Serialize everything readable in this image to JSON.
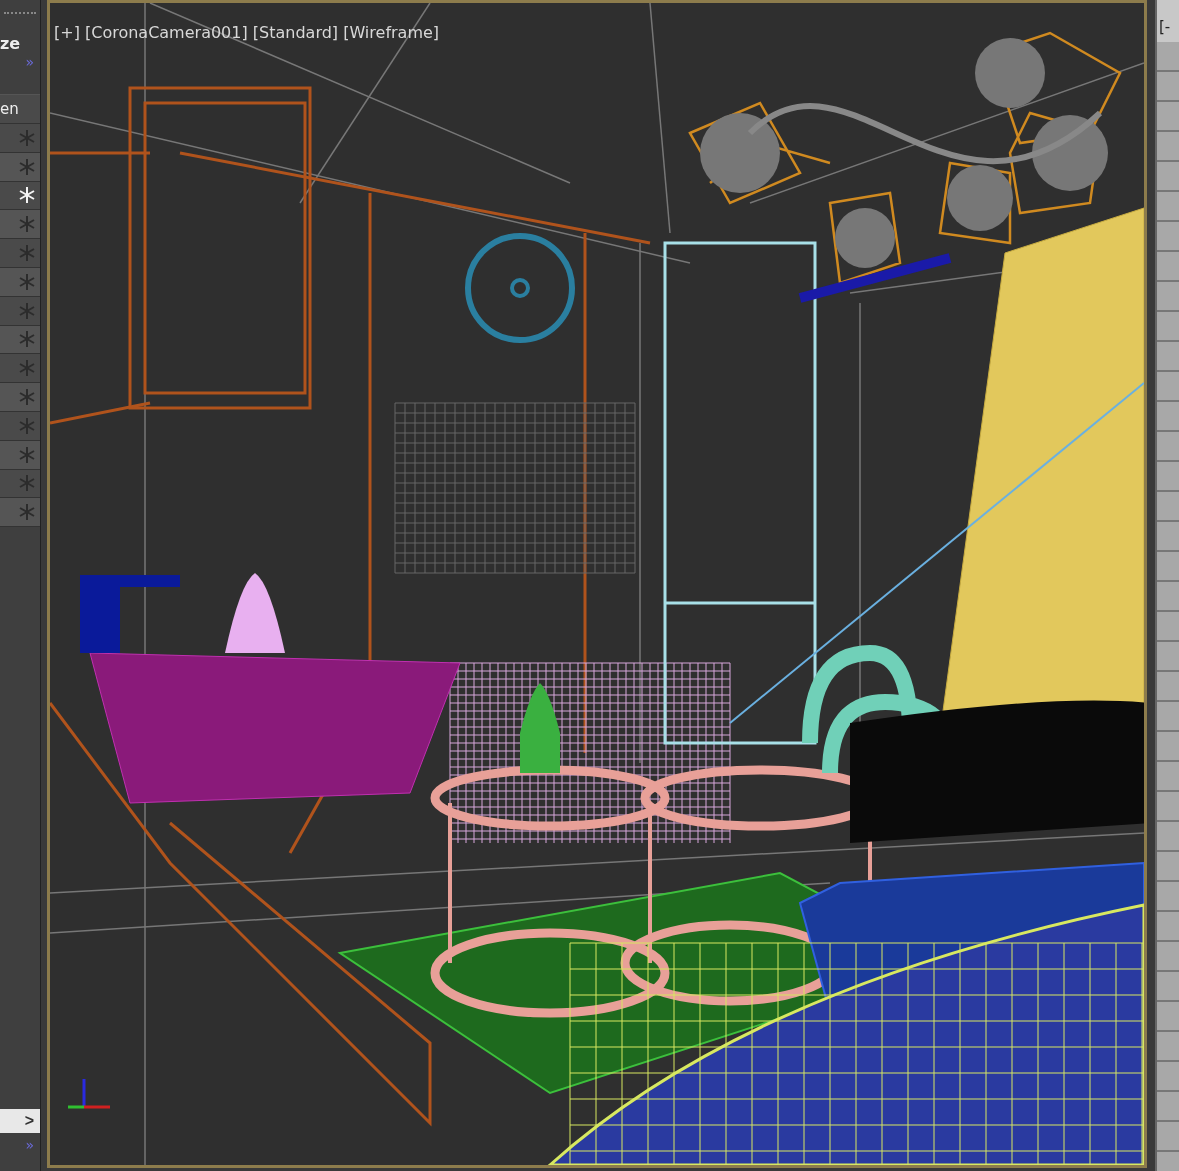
{
  "left_panel": {
    "header_text": "ze",
    "expand_glyph": "»",
    "column_header": "en",
    "rows": [
      {
        "active": false
      },
      {
        "active": false
      },
      {
        "active": true
      },
      {
        "active": false
      },
      {
        "active": false
      },
      {
        "active": false
      },
      {
        "active": false
      },
      {
        "active": false
      },
      {
        "active": false
      },
      {
        "active": false
      },
      {
        "active": false
      },
      {
        "active": false
      },
      {
        "active": false
      },
      {
        "active": false
      }
    ],
    "next_button": ">",
    "footer_glyph": "»"
  },
  "viewport": {
    "label": "[+] [CoronaCamera001] [Standard] [Wireframe]"
  },
  "right_panel": {
    "label": "[-"
  }
}
